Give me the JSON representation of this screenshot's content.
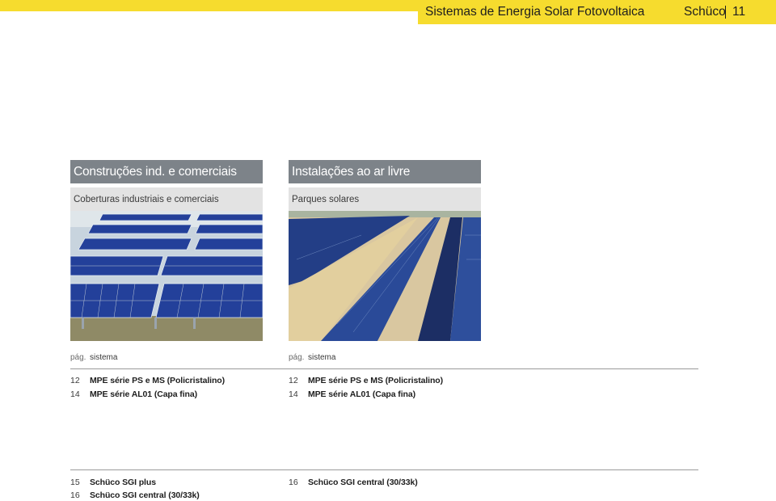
{
  "header": {
    "title": "Sistemas de Energia Solar Fotovoltaica",
    "brand": "Schüco",
    "page": "11"
  },
  "columns": [
    {
      "category": "Construções ind. e comerciais",
      "subcategory": "Coberturas industriais e comerciais",
      "list_head": {
        "page_label": "pág.",
        "system_label": "sistema"
      },
      "modules": [
        {
          "page": "12",
          "name": "MPE série PS e MS (Policristalino)"
        },
        {
          "page": "14",
          "name": "MPE série AL01 (Capa fina)"
        }
      ],
      "inverters": [
        {
          "page": "15",
          "name": "Schüco SGI plus"
        },
        {
          "page": "16",
          "name": "Schüco SGI central (30/33k)"
        }
      ]
    },
    {
      "category": "Instalações ao ar livre",
      "subcategory": "Parques solares",
      "list_head": {
        "page_label": "pág.",
        "system_label": "sistema"
      },
      "modules": [
        {
          "page": "12",
          "name": "MPE série PS e MS (Policristalino)"
        },
        {
          "page": "14",
          "name": "MPE série AL01 (Capa fina)"
        }
      ],
      "inverters": [
        {
          "page": "16",
          "name": "Schüco SGI central (30/33k)"
        }
      ]
    }
  ],
  "colors": {
    "accent_yellow": "#f6dc2e",
    "header_grey": "#7d8389",
    "subheader_grey": "#e3e3e3",
    "panel_blue": "#23409a"
  }
}
